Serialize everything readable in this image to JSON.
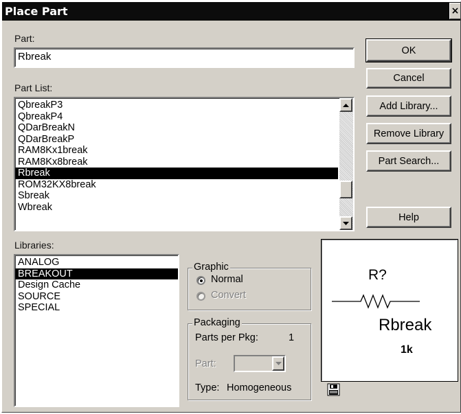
{
  "window": {
    "title": "Place Part",
    "close_glyph": "×"
  },
  "part": {
    "label": "Part:",
    "value": "Rbreak"
  },
  "part_list": {
    "label": "Part List:",
    "items": [
      "QbreakP3",
      "QbreakP4",
      "QDarBreakN",
      "QDarBreakP",
      "RAM8Kx1break",
      "RAM8Kx8break",
      "Rbreak",
      "ROM32KX8break",
      "Sbreak",
      "Wbreak"
    ],
    "selected": "Rbreak"
  },
  "buttons": {
    "ok": "OK",
    "cancel": "Cancel",
    "add_library": "Add Library...",
    "remove_library": "Remove Library",
    "part_search": "Part Search...",
    "help": "Help"
  },
  "libraries": {
    "label": "Libraries:",
    "items": [
      "ANALOG",
      "BREAKOUT",
      "Design Cache",
      "SOURCE",
      "SPECIAL"
    ],
    "selected": "BREAKOUT"
  },
  "graphic": {
    "legend": "Graphic",
    "normal_label": "Normal",
    "convert_label": "Convert",
    "selected": "Normal"
  },
  "packaging": {
    "legend": "Packaging",
    "parts_per_pkg_label": "Parts per Pkg:",
    "parts_per_pkg_value": "1",
    "part_label": "Part:",
    "part_value": "",
    "type_label": "Type:",
    "type_value": "Homogeneous"
  },
  "preview": {
    "refdes": "R?",
    "name": "Rbreak",
    "value": "1k"
  },
  "icons": {
    "close": "close-icon",
    "scroll_up": "arrow-up-icon",
    "scroll_down": "arrow-down-icon",
    "dropdown": "chevron-down-icon",
    "preview_toggle": "save-preview-icon"
  },
  "colors": {
    "dialog_face": "#d4d0c8",
    "titlebar": "#0c0c0c",
    "selection": "#000000"
  }
}
